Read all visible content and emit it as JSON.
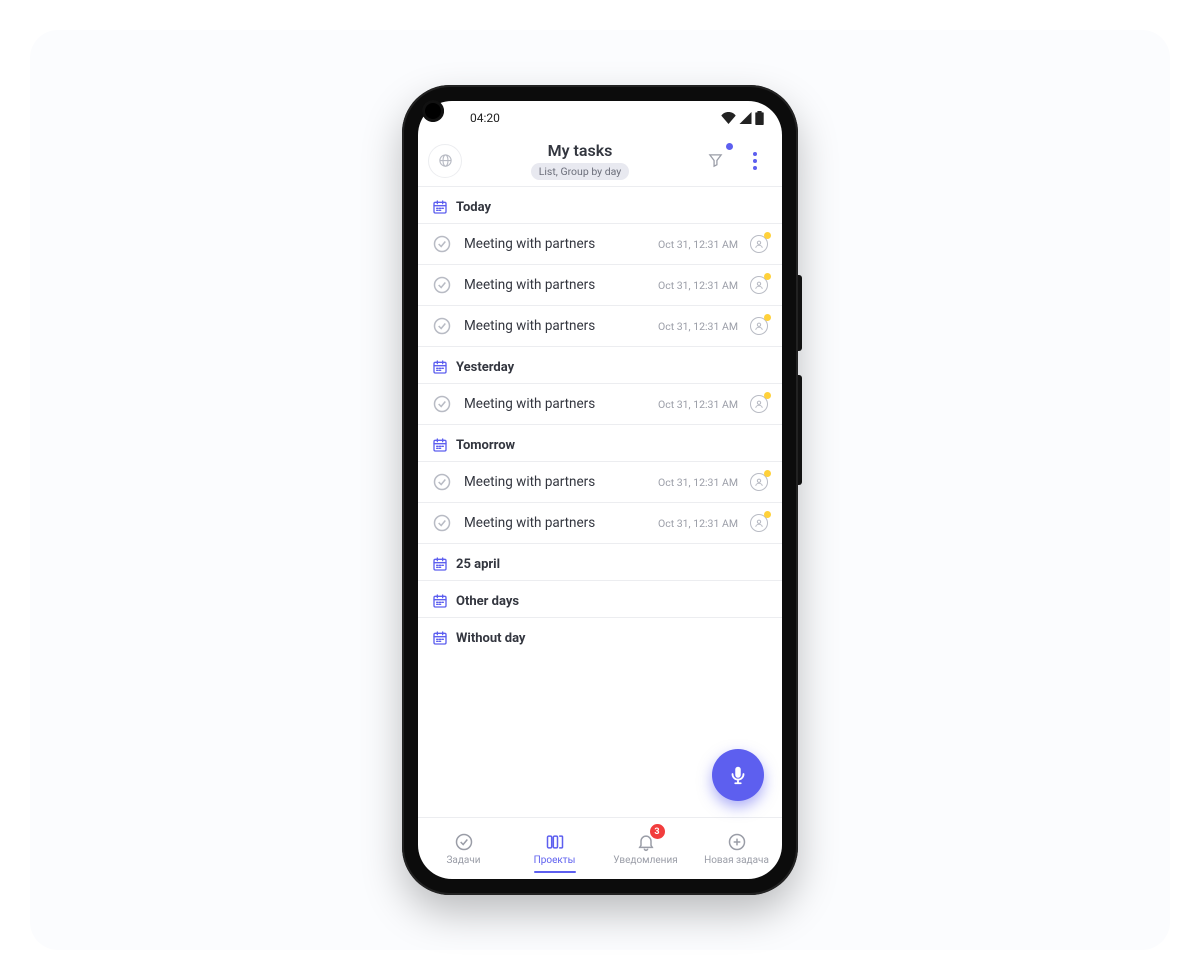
{
  "status_bar": {
    "time": "04:20"
  },
  "header": {
    "title": "My tasks",
    "view_chip": "List, Group by day"
  },
  "groups": [
    {
      "label": "Today",
      "tasks": [
        {
          "title": "Meeting with partners",
          "time": "Oct 31, 12:31 AM"
        },
        {
          "title": "Meeting with partners",
          "time": "Oct 31, 12:31 AM"
        },
        {
          "title": "Meeting with partners",
          "time": "Oct 31, 12:31 AM"
        }
      ]
    },
    {
      "label": "Yesterday",
      "tasks": [
        {
          "title": "Meeting with partners",
          "time": "Oct 31, 12:31 AM"
        }
      ]
    },
    {
      "label": "Tomorrow",
      "tasks": [
        {
          "title": "Meeting with partners",
          "time": "Oct 31, 12:31 AM"
        },
        {
          "title": "Meeting with partners",
          "time": "Oct 31, 12:31 AM"
        }
      ]
    },
    {
      "label": "25 april",
      "tasks": []
    },
    {
      "label": "Other days",
      "tasks": []
    },
    {
      "label": "Without day",
      "tasks": []
    }
  ],
  "nav": {
    "items": [
      {
        "label": "Задачи"
      },
      {
        "label": "Проекты"
      },
      {
        "label": "Уведомления",
        "badge": "3"
      },
      {
        "label": "Новая задача"
      }
    ]
  }
}
